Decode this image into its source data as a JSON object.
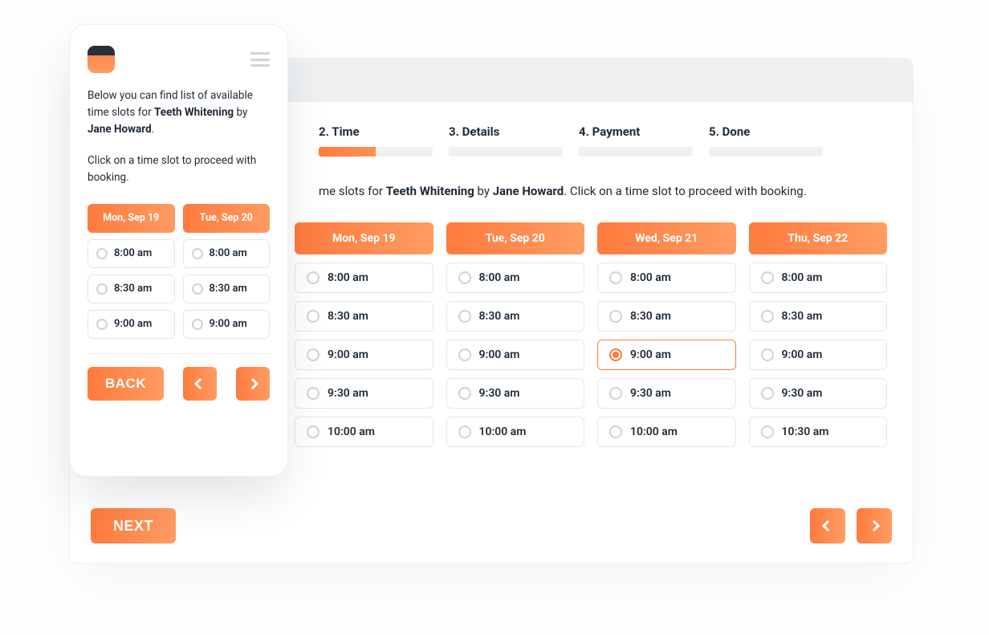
{
  "steps": [
    {
      "label": "2. Time",
      "state": "partial"
    },
    {
      "label": "3. Details",
      "state": "empty"
    },
    {
      "label": "4. Payment",
      "state": "empty"
    },
    {
      "label": "5. Done",
      "state": "empty"
    }
  ],
  "blurb": {
    "prefix_desktop": "me slots for ",
    "service": "Teeth Whitening",
    "by_word": " by ",
    "provider": "Jane Howard",
    "suffix_desktop": ". Click on a time slot to proceed with booking.",
    "mobile_line1_a": "Below you can find list of available time slots for ",
    "mobile_line1_b": " by ",
    "mobile_line1_c": ".",
    "mobile_line2": "Click on a time slot to proceed with booking."
  },
  "desktop_days": [
    {
      "head": "Mon, Sep 19",
      "slots": [
        "8:00 am",
        "8:30 am",
        "9:00 am",
        "9:30 am",
        "10:00 am"
      ],
      "selected": null
    },
    {
      "head": "Tue, Sep 20",
      "slots": [
        "8:00 am",
        "8:30 am",
        "9:00 am",
        "9:30 am",
        "10:00 am"
      ],
      "selected": null
    },
    {
      "head": "Wed, Sep 21",
      "slots": [
        "8:00 am",
        "8:30 am",
        "9:00 am",
        "9:30 am",
        "10:00 am"
      ],
      "selected": "9:00 am"
    },
    {
      "head": "Thu, Sep 22",
      "slots": [
        "8:00 am",
        "8:30 am",
        "9:00 am",
        "9:30 am",
        "10:30 am"
      ],
      "selected": null
    }
  ],
  "mobile_days": [
    {
      "head": "Mon, Sep 19",
      "slots": [
        "8:00 am",
        "8:30 am",
        "9:00 am"
      ]
    },
    {
      "head": "Tue, Sep 20",
      "slots": [
        "8:00 am",
        "8:30 am",
        "9:00 am"
      ]
    }
  ],
  "buttons": {
    "next": "NEXT",
    "back": "BACK"
  }
}
